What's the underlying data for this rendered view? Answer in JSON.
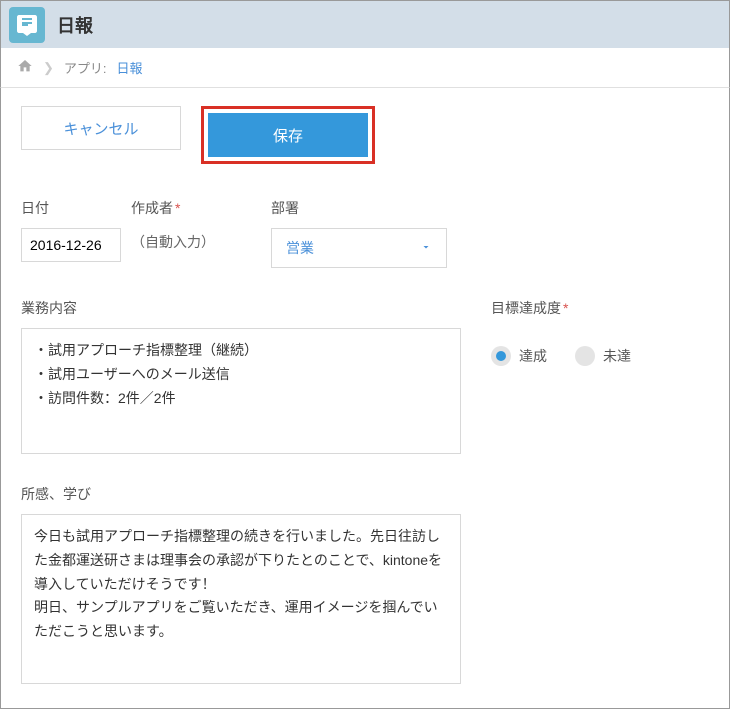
{
  "header": {
    "title": "日報"
  },
  "breadcrumb": {
    "app_label": "アプリ:",
    "app_name": "日報"
  },
  "buttons": {
    "cancel": "キャンセル",
    "save": "保存"
  },
  "fields": {
    "date": {
      "label": "日付",
      "value": "2016-12-26"
    },
    "author": {
      "label": "作成者",
      "value": "（自動入力）"
    },
    "dept": {
      "label": "部署",
      "selected": "営業"
    },
    "gyomu": {
      "label": "業務内容",
      "value": "・試用アプローチ指標整理（継続）\n・試用ユーザーへのメール送信\n・訪問件数：2件／2件"
    },
    "goal": {
      "label": "目標達成度",
      "options": {
        "done": "達成",
        "undone": "未達"
      }
    },
    "shokan": {
      "label": "所感、学び",
      "value": "今日も試用アプローチ指標整理の続きを行いました。先日往訪した金都運送研さまは理事会の承認が下りたとのことで、kintoneを導入していただけそうです！\n明日、サンプルアプリをご覧いただき、運用イメージを掴んでいただこうと思います。"
    }
  }
}
